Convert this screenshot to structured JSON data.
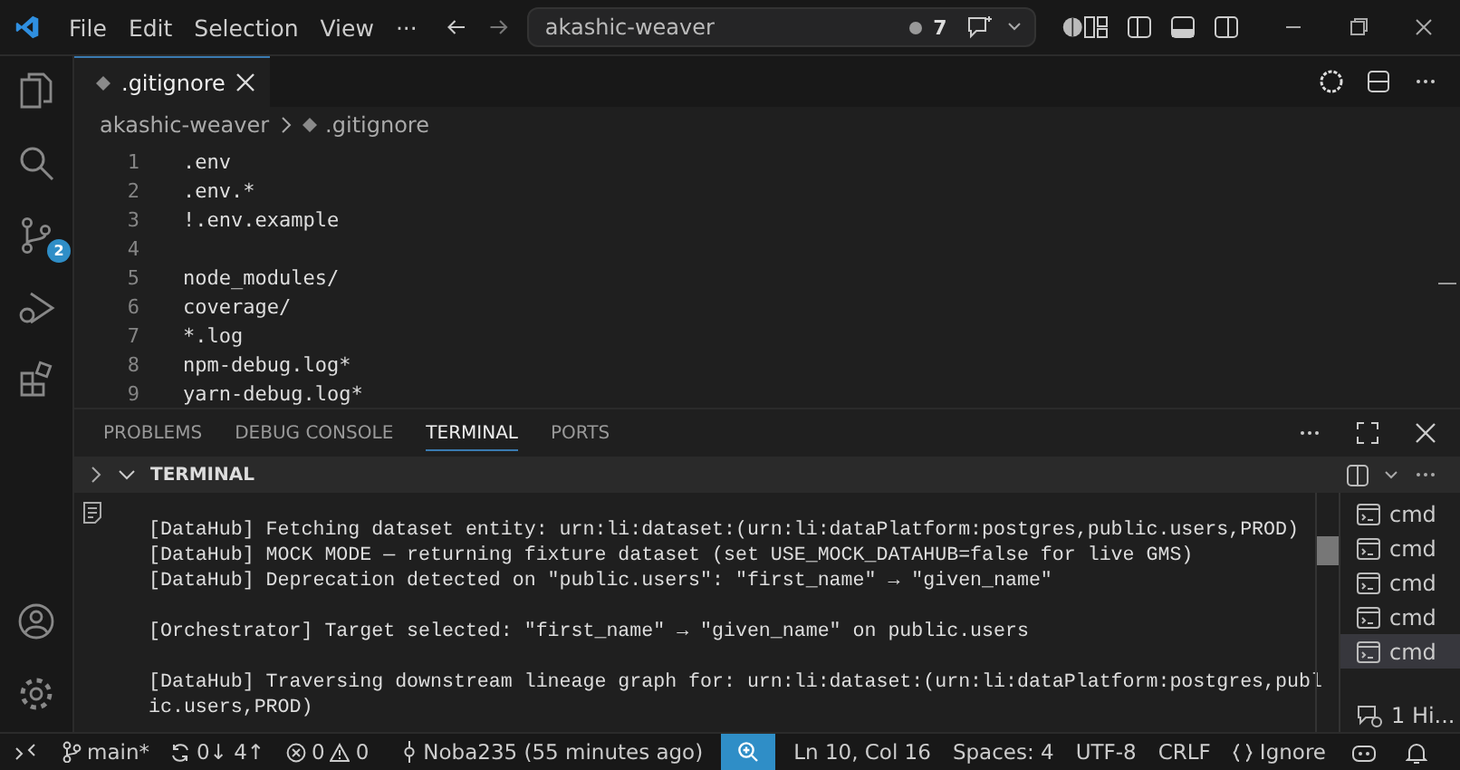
{
  "titlebar": {
    "menu": [
      "File",
      "Edit",
      "Selection",
      "View",
      "···"
    ],
    "search": {
      "value": "akashic-weaver"
    },
    "badge": "7"
  },
  "activity_bar": {
    "scm_badge": "2"
  },
  "tabs": [
    {
      "label": ".gitignore",
      "selected": true
    }
  ],
  "breadcrumb": [
    "akashic-weaver",
    ".gitignore"
  ],
  "editor": {
    "lines": [
      {
        "n": "1",
        "text": ".env"
      },
      {
        "n": "2",
        "text": ".env.*"
      },
      {
        "n": "3",
        "text": "!.env.example"
      },
      {
        "n": "4"
      },
      {
        "n": "5",
        "text": "node_modules/"
      },
      {
        "n": "6",
        "text": "coverage/"
      },
      {
        "n": "7",
        "text": "*.log"
      },
      {
        "n": "8",
        "text": "npm-debug.log*"
      },
      {
        "n": "9",
        "text": "yarn-debug.log*"
      }
    ]
  },
  "panel": {
    "tabs": [
      {
        "label": "PROBLEMS",
        "selected": false
      },
      {
        "label": "DEBUG CONSOLE",
        "selected": false
      },
      {
        "label": "TERMINAL",
        "selected": true
      },
      {
        "label": "PORTS",
        "selected": false
      }
    ],
    "section": "TERMINAL",
    "output_blocks": [
      [
        "[DataHub] Fetching dataset entity: urn:li:dataset:(urn:li:dataPlatform:postgres,public.users,PROD)",
        "[DataHub] MOCK MODE — returning fixture dataset (set USE_MOCK_DATAHUB=false for live GMS)",
        "[DataHub] Deprecation detected on \"public.users\": \"first_name\" → \"given_name\""
      ],
      [
        "[Orchestrator] Target selected: \"first_name\" → \"given_name\" on public.users"
      ],
      [
        "[DataHub] Traversing downstream lineage graph for: urn:li:dataset:(urn:li:dataPlatform:postgres,public.users,PROD)"
      ]
    ],
    "terminals": [
      {
        "label": "cmd",
        "selected": false
      },
      {
        "label": "cmd",
        "selected": false
      },
      {
        "label": "cmd",
        "selected": false
      },
      {
        "label": "cmd",
        "selected": false
      },
      {
        "label": "cmd",
        "selected": true
      }
    ],
    "history": "1 Hi..."
  },
  "status_bar": {
    "branch": "main*",
    "sync": "0↓ 4↑",
    "errors": "0",
    "warnings": "0",
    "blame": "Noba235 (55 minutes ago)",
    "position": "Ln 10, Col 16",
    "spaces": "Spaces: 4",
    "encoding": "UTF-8",
    "eol": "CRLF",
    "language": "Ignore"
  }
}
